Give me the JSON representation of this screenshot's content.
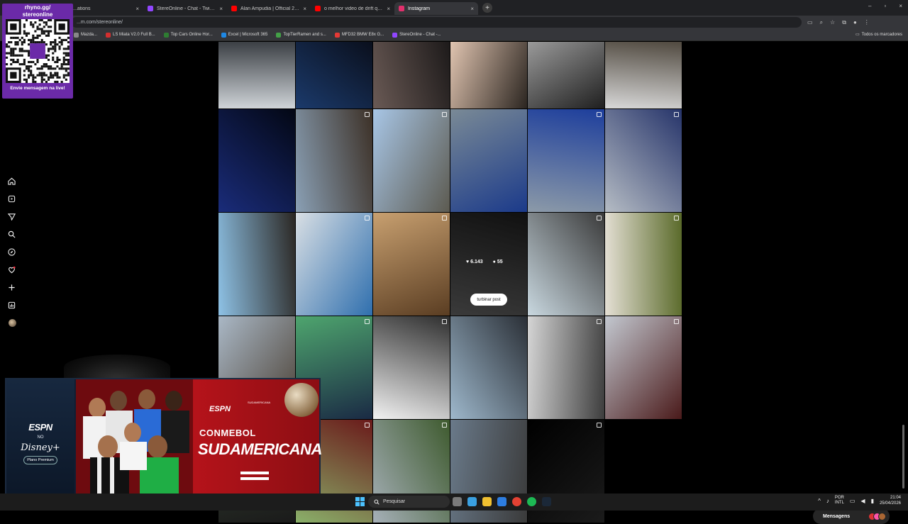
{
  "browser": {
    "tabs": [
      {
        "label": "...ations",
        "color": "#5f6368",
        "active": false
      },
      {
        "label": "StereOnline - Chat - Twitch",
        "color": "#9146ff",
        "active": false
      },
      {
        "label": "Alan Ampudia | Official 2026 S...",
        "color": "#ff0000",
        "active": false
      },
      {
        "label": "o melhor video de drift que e...",
        "color": "#ff0000",
        "active": false
      },
      {
        "label": "Instagram",
        "color": "#e1306c",
        "active": true
      }
    ],
    "url": "...m.com/stereonline/",
    "bookmarks": [
      {
        "label": "Mazda...",
        "color": "#888888"
      },
      {
        "label": "LS Miata V2.0 Full B...",
        "color": "#d32f2f"
      },
      {
        "label": "Top Cars Online Hor...",
        "color": "#2e7d32"
      },
      {
        "label": "Excel | Microsoft 365",
        "color": "#1e88e5"
      },
      {
        "label": "TopTierRamen and s...",
        "color": "#43a047"
      },
      {
        "label": "MFD32 BMW E8x G...",
        "color": "#e53935"
      },
      {
        "label": "StereOnline - Chat -...",
        "color": "#9146ff"
      }
    ],
    "all_bookmarks": "Todos os marcadores",
    "close_glyph": "×",
    "new_tab_glyph": "+",
    "window_controls": [
      "–",
      "▫",
      "×"
    ]
  },
  "qr_overlay": {
    "title_line1": "rhyno.gg/",
    "title_line2": "stereonline",
    "footer": "Envie mensagem na live!"
  },
  "sidenav": {
    "items": [
      "home-icon",
      "reels-icon",
      "direct-icon",
      "search-icon",
      "explore-icon",
      "notifications-icon",
      "create-icon",
      "dashboard-icon",
      "profile-avatar"
    ]
  },
  "hover_post": {
    "likes": "6.143",
    "comments": "55",
    "boost_label": "turbinar post"
  },
  "posts": [
    {
      "c1": "#cfd4d8",
      "c2": "#3b3f44"
    },
    {
      "c1": "#1b3a6b",
      "c2": "#0a0f1c"
    },
    {
      "c1": "#6a5a55",
      "c2": "#1d1a1a"
    },
    {
      "c1": "#e0c4b0",
      "c2": "#2b2520"
    },
    {
      "c1": "#9a9a9a",
      "c2": "#1f1f1f"
    },
    {
      "c1": "#d8d8d8",
      "c2": "#50493f"
    },
    {
      "c1": "#1a2c7a",
      "c2": "#030714"
    },
    {
      "c1": "#8aa0b5",
      "c2": "#3c3026"
    },
    {
      "c1": "#a8c6e6",
      "c2": "#5c5a50"
    },
    {
      "c1": "#7a8a96",
      "c2": "#1b3a8a"
    },
    {
      "c1": "#8c9aa8",
      "c2": "#1d3e9c"
    },
    {
      "c1": "#b5bcc4",
      "c2": "#26346a"
    },
    {
      "c1": "#8ec2e6",
      "c2": "#2b2723"
    },
    {
      "c1": "#d9dfe4",
      "c2": "#2f6fae"
    },
    {
      "c1": "#c8a070",
      "c2": "#5a3d22"
    },
    {
      "c1": "#5a5a5a",
      "c2": "#1a1a1a"
    },
    {
      "c1": "#c9d8e0",
      "c2": "#3a3a3a"
    },
    {
      "c1": "#e5e0d5",
      "c2": "#5a6a2a"
    },
    {
      "c1": "#aab8c6",
      "c2": "#4a3f33"
    },
    {
      "c1": "#4ea56e",
      "c2": "#1a2a44"
    },
    {
      "c1": "#f2f2f2",
      "c2": "#2e2e2e"
    },
    {
      "c1": "#9eb8cc",
      "c2": "#2a2f36"
    },
    {
      "c1": "#d5d5d5",
      "c2": "#3d3d3d"
    },
    {
      "c1": "#c3c8d0",
      "c2": "#4a1a1a"
    },
    {
      "c1": "#3a4a36",
      "c2": "#1a1a1a"
    },
    {
      "c1": "#8ab06a",
      "c2": "#6a1a1a"
    },
    {
      "c1": "#a6b0b8",
      "c2": "#3e5a2e"
    },
    {
      "c1": "#6a7a8a",
      "c2": "#3a3a3a"
    },
    {
      "c1": "#000000",
      "c2": "#1b1b1b"
    }
  ],
  "espn_ad": {
    "espn": "ESPN",
    "no": "NO",
    "disney": "Disney+",
    "plano": "Plano Premium",
    "espn2": "ESPN",
    "sud_badge": "SUDAMERICANA",
    "conmebol": "CONMEBOL",
    "sudamericana": "SUDAMERICANA"
  },
  "messages_pill": {
    "label": "Mensagens"
  },
  "taskbar": {
    "search_placeholder": "Pesquisar",
    "lang_top": "POR",
    "lang_bottom": "INTL",
    "time": "21:04",
    "date": "25/04/2026",
    "tray_glyph": "^"
  }
}
